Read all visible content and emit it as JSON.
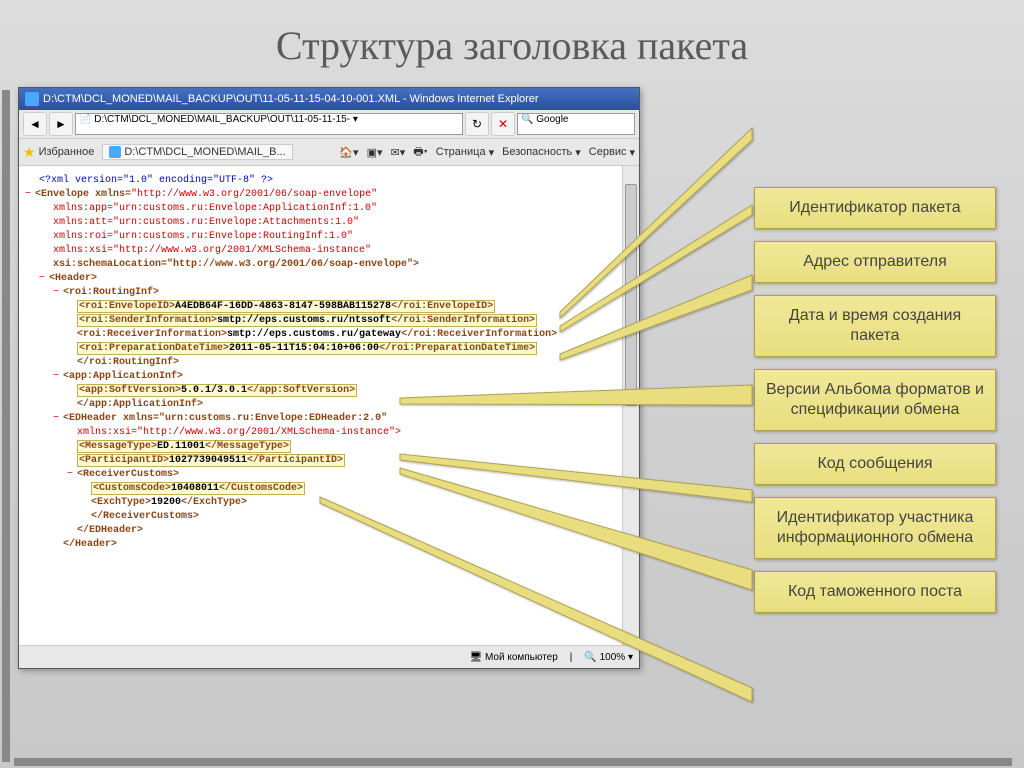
{
  "slide": {
    "title": "Структура заголовка пакета"
  },
  "ie": {
    "title": "D:\\CTM\\DCL_MONED\\MAIL_BACKUP\\OUT\\11-05-11-15-04-10-001.XML - Windows Internet Explorer",
    "address": "D:\\CTM\\DCL_MONED\\MAIL_BACKUP\\OUT\\11-05-11-15-",
    "search": "Google",
    "favorites": "Избранное",
    "tab": "D:\\CTM\\DCL_MONED\\MAIL_B...",
    "menu": {
      "page": "Страница",
      "security": "Безопасность",
      "service": "Сервис"
    },
    "zoom": "100%",
    "status": "Мой компьютер"
  },
  "xml": {
    "decl": "<?xml version=\"1.0\" encoding=\"UTF-8\" ?>",
    "envOpen": "<Envelope xmlns=",
    "envNs": "\"http://www.w3.org/2001/06/soap-envelope\"",
    "nsApp": "xmlns:app=\"urn:customs.ru:Envelope:ApplicationInf:1.0\"",
    "nsAtt": "xmlns:att=\"urn:customs.ru:Envelope:Attachments:1.0\"",
    "nsRoi": "xmlns:roi=\"urn:customs.ru:Envelope:RoutingInf:1.0\"",
    "nsXsi": "xmlns:xsi=\"http://www.w3.org/2001/XMLSchema-instance\"",
    "xsiLoc": "xsi:schemaLocation=\"http://www.w3.org/2001/06/soap-envelope\">",
    "header": "<Header>",
    "roiRouting": "<roi:RoutingInf>",
    "envIdOpen": "<roi:EnvelopeID>",
    "envIdVal": "A4EDB64F-16DD-4863-8147-598BAB115278",
    "envIdClose": "</roi:EnvelopeID>",
    "senderOpen": "<roi:SenderInformation>",
    "senderVal": "smtp://eps.customs.ru/ntssoft",
    "senderClose": "</roi:SenderInformation>",
    "recvOpen": "<roi:ReceiverInformation>",
    "recvVal": "smtp://eps.customs.ru/gateway",
    "recvClose": "</roi:ReceiverInformation>",
    "prepOpen": "<roi:PreparationDateTime>",
    "prepVal": "2011-05-11T15:04:10+06:00",
    "prepClose": "</roi:PreparationDateTime>",
    "roiRoutingClose": "</roi:RoutingInf>",
    "appInf": "<app:ApplicationInf>",
    "softOpen": "<app:SoftVersion>",
    "softVal": "5.0.1/3.0.1",
    "softClose": "</app:SoftVersion>",
    "appInfClose": "</app:ApplicationInf>",
    "edHeader": "<EDHeader xmlns=\"urn:customs.ru:Envelope:EDHeader:2.0\"",
    "edXsi": "xmlns:xsi=\"http://www.w3.org/2001/XMLSchema-instance\">",
    "msgOpen": "<MessageType>",
    "msgVal": "ED.11001",
    "msgClose": "</MessageType>",
    "partOpen": "<ParticipantID>",
    "partVal": "1027739049511",
    "partClose": "</ParticipantID>",
    "recvCust": "<ReceiverCustoms>",
    "custOpen": "<CustomsCode>",
    "custVal": "10408011",
    "custClose": "</CustomsCode>",
    "exchOpen": "<ExchType>",
    "exchVal": "19200",
    "exchClose": "</ExchType>",
    "recvCustClose": "</ReceiverCustoms>",
    "edHeaderClose": "</EDHeader>",
    "headerClose": "</Header>"
  },
  "labels": {
    "l1": "Идентификатор пакета",
    "l2": "Адрес отправителя",
    "l3": "Дата и время создания пакета",
    "l4": "Версии Альбома форматов и спецификации обмена",
    "l5": "Код сообщения",
    "l6": "Идентификатор участника информационного обмена",
    "l7": "Код таможенного поста"
  }
}
